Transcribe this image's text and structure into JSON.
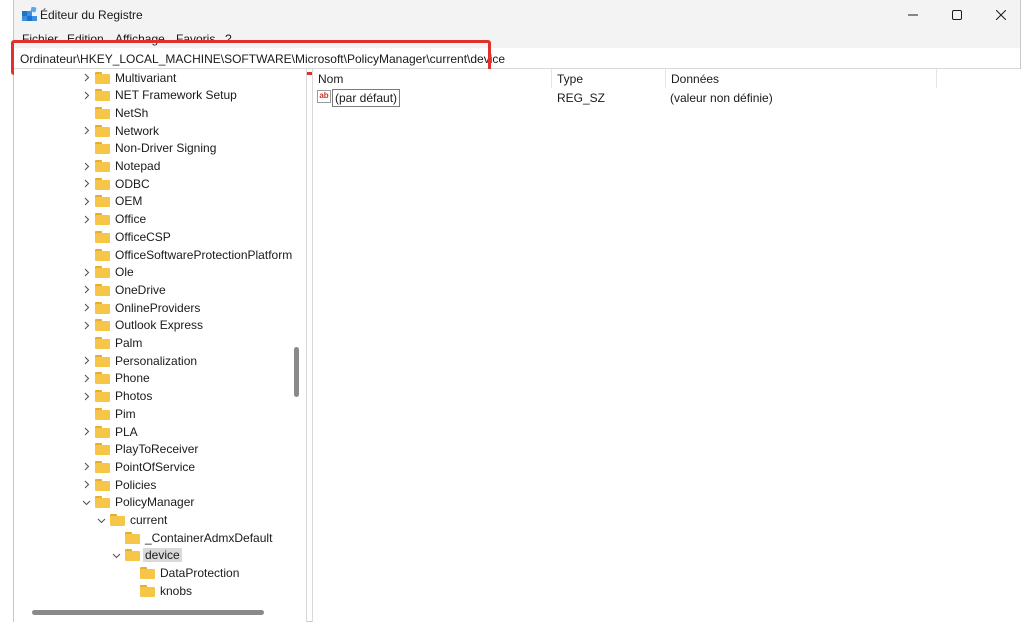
{
  "window": {
    "title": "Éditeur du Registre"
  },
  "menu": {
    "items": [
      "Fichier",
      "Edition",
      "Affichage",
      "Favoris",
      "?"
    ]
  },
  "address": {
    "path": "Ordinateur\\HKEY_LOCAL_MACHINE\\SOFTWARE\\Microsoft\\PolicyManager\\current\\device"
  },
  "tree": {
    "items": [
      {
        "label": "Multivariant",
        "level": 0,
        "expander": "collapsed"
      },
      {
        "label": "NET Framework Setup",
        "level": 0,
        "expander": "collapsed"
      },
      {
        "label": "NetSh",
        "level": 0,
        "expander": "none"
      },
      {
        "label": "Network",
        "level": 0,
        "expander": "collapsed"
      },
      {
        "label": "Non-Driver Signing",
        "level": 0,
        "expander": "none"
      },
      {
        "label": "Notepad",
        "level": 0,
        "expander": "collapsed"
      },
      {
        "label": "ODBC",
        "level": 0,
        "expander": "collapsed"
      },
      {
        "label": "OEM",
        "level": 0,
        "expander": "collapsed"
      },
      {
        "label": "Office",
        "level": 0,
        "expander": "collapsed"
      },
      {
        "label": "OfficeCSP",
        "level": 0,
        "expander": "none"
      },
      {
        "label": "OfficeSoftwareProtectionPlatform",
        "level": 0,
        "expander": "none"
      },
      {
        "label": "Ole",
        "level": 0,
        "expander": "collapsed"
      },
      {
        "label": "OneDrive",
        "level": 0,
        "expander": "collapsed"
      },
      {
        "label": "OnlineProviders",
        "level": 0,
        "expander": "collapsed"
      },
      {
        "label": "Outlook Express",
        "level": 0,
        "expander": "collapsed"
      },
      {
        "label": "Palm",
        "level": 0,
        "expander": "none"
      },
      {
        "label": "Personalization",
        "level": 0,
        "expander": "collapsed"
      },
      {
        "label": "Phone",
        "level": 0,
        "expander": "collapsed"
      },
      {
        "label": "Photos",
        "level": 0,
        "expander": "collapsed"
      },
      {
        "label": "Pim",
        "level": 0,
        "expander": "none"
      },
      {
        "label": "PLA",
        "level": 0,
        "expander": "collapsed"
      },
      {
        "label": "PlayToReceiver",
        "level": 0,
        "expander": "none"
      },
      {
        "label": "PointOfService",
        "level": 0,
        "expander": "collapsed"
      },
      {
        "label": "Policies",
        "level": 0,
        "expander": "collapsed"
      },
      {
        "label": "PolicyManager",
        "level": 0,
        "expander": "expanded"
      },
      {
        "label": "current",
        "level": 1,
        "expander": "expanded"
      },
      {
        "label": "_ContainerAdmxDefault",
        "level": 2,
        "expander": "none"
      },
      {
        "label": "device",
        "level": 2,
        "expander": "expanded",
        "selected": true
      },
      {
        "label": "DataProtection",
        "level": 3,
        "expander": "none"
      },
      {
        "label": "knobs",
        "level": 3,
        "expander": "none"
      }
    ]
  },
  "values": {
    "columns": [
      "Nom",
      "Type",
      "Données"
    ],
    "rows": [
      {
        "name": "(par défaut)",
        "type": "REG_SZ",
        "data": "(valeur non définie)",
        "icon": "string-value-icon",
        "icon_text": "ab"
      }
    ]
  },
  "colors": {
    "highlight": "#e0322a",
    "folder": "#f5c648",
    "selected": "#d9d9d9"
  }
}
